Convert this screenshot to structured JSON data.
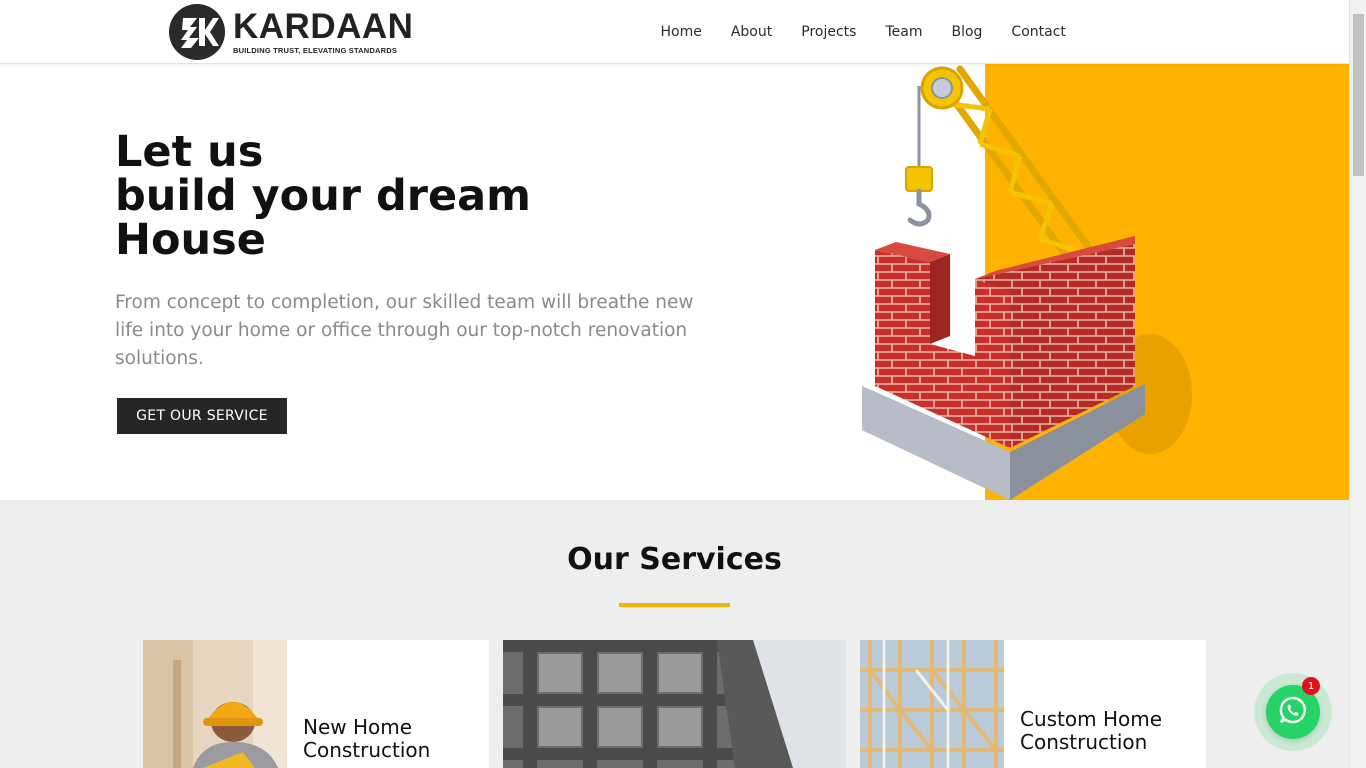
{
  "brand": {
    "name": "KARDAAN",
    "tagline": "BUILDING TRUST, ELEVATING STANDARDS",
    "logo_mark_letter": "K",
    "accent_color": "#f5b301",
    "dark_color": "#262626"
  },
  "nav": {
    "items": [
      {
        "label": "Home"
      },
      {
        "label": "About"
      },
      {
        "label": "Projects"
      },
      {
        "label": "Team"
      },
      {
        "label": "Blog"
      },
      {
        "label": "Contact"
      }
    ]
  },
  "hero": {
    "title_line1": "Let us",
    "title_line2": "build your dream",
    "title_line3": "House",
    "description": "From concept to completion, our skilled team will breathe new life into your home or office through our top-notch renovation solutions.",
    "cta_label": "GET OUR SERVICE",
    "illustration_icon": "crane-brick-wall-illustration"
  },
  "services": {
    "title": "Our Services",
    "cards": [
      {
        "title": "New Home Construction",
        "image": "worker-hardhat-photo"
      },
      {
        "title": "",
        "image": "concrete-building-frame-photo"
      },
      {
        "title": "Custom Home Construction",
        "image": "wood-frame-structure-photo"
      }
    ]
  },
  "whatsapp": {
    "icon": "whatsapp-icon",
    "badge_count": "1",
    "color": "#25d366"
  }
}
